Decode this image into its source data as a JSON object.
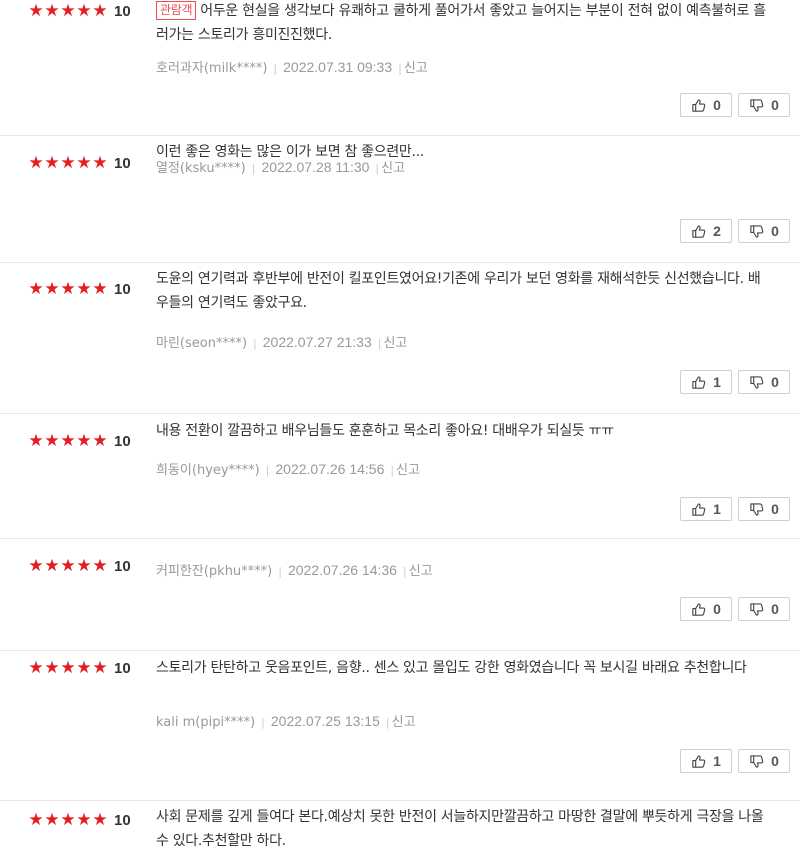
{
  "reviews": [
    {
      "stars": 5,
      "score": "10",
      "badge": "관람객",
      "text": "어두운 현실을 생각보다 유쾌하고 쿨하게 풀어가서 좋았고 늘어지는 부분이 전혀 없이 예측불허로 흘러가는 스토리가 흥미진진했다.",
      "user": "호러과자(milk****)",
      "date": "2022.07.31 09:33",
      "report": "신고",
      "likes": "0",
      "dislikes": "0"
    },
    {
      "stars": 5,
      "score": "10",
      "badge": "",
      "text": "이런 좋은 영화는 많은 이가 보면 참 좋으련만...",
      "user": "열정(ksku****)",
      "date": "2022.07.28 11:30",
      "report": "신고",
      "likes": "2",
      "dislikes": "0"
    },
    {
      "stars": 5,
      "score": "10",
      "badge": "",
      "text": "도윤의 연기력과 후반부에 반전이 킬포인트였어요!기존에 우리가 보던 영화를 재해석한듯 신선했습니다. 배우들의 연기력도 좋았구요.",
      "user": "마린(seon****)",
      "date": "2022.07.27 21:33",
      "report": "신고",
      "likes": "1",
      "dislikes": "0"
    },
    {
      "stars": 5,
      "score": "10",
      "badge": "",
      "text": "내용 전환이 깔끔하고 배우님들도 훈훈하고 목소리 좋아요! 대배우가 되실듯 ㅠㅠ",
      "user": "희동이(hyey****)",
      "date": "2022.07.26 14:56",
      "report": "신고",
      "likes": "1",
      "dislikes": "0"
    },
    {
      "stars": 5,
      "score": "10",
      "badge": "",
      "text": "",
      "user": "커피한잔(pkhu****)",
      "date": "2022.07.26 14:36",
      "report": "신고",
      "likes": "0",
      "dislikes": "0"
    },
    {
      "stars": 5,
      "score": "10",
      "badge": "",
      "text": "스토리가 탄탄하고 웃음포인트, 음향.. 센스 있고 몰입도 강한 영화였습니다 꼭 보시길 바래요 추천합니다",
      "user": "kali m(pipi****)",
      "date": "2022.07.25 13:15",
      "report": "신고",
      "likes": "1",
      "dislikes": "0"
    },
    {
      "stars": 5,
      "score": "10",
      "badge": "",
      "text": "사회 문제를 깊게 들여다 본다.예상치 못한 반전이 서늘하지만깔끔하고 마땅한 결말에 뿌듯하게 극장을 나올 수 있다.추천할만 하다.",
      "user": "",
      "date": "",
      "report": "",
      "likes": "",
      "dislikes": ""
    }
  ]
}
